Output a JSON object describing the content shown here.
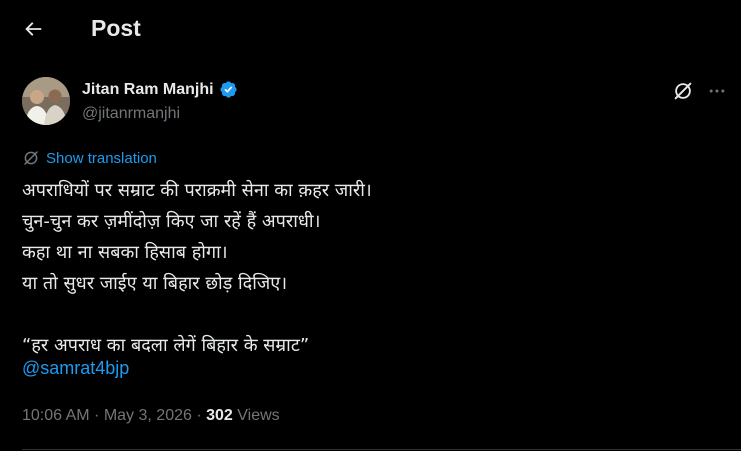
{
  "header": {
    "title": "Post"
  },
  "author": {
    "name": "Jitan Ram Manjhi",
    "handle": "@jitanrmanjhi"
  },
  "translate": {
    "label": "Show translation"
  },
  "tweet": {
    "line1": "अपराधियों पर सम्राट की पराक्रमी सेना का क़हर जारी।",
    "line2": "चुन-चुन कर ज़मींदोज़ किए जा रहें हैं अपराधी।",
    "line3": "कहा था ना सबका हिसाब होगा।",
    "line4": "या तो सुधर जाईए या बिहार छोड़ दिजिए।",
    "quote": "“हर अपराध का बदला लेगें बिहार के सम्राट”",
    "mention": "@samrat4bjp"
  },
  "meta": {
    "time": "10:06 AM",
    "sep1": " · ",
    "date": "May 3, 2026",
    "sep2": " · ",
    "views": "302",
    "views_label": " Views"
  },
  "colors": {
    "background": "#000000",
    "text": "#e7e9ea",
    "muted": "#71767b",
    "link": "#1d9bf0"
  },
  "icons": {
    "back": "arrow-left-icon",
    "verified": "verified-badge-icon",
    "grok": "grok-icon",
    "more": "more-horizontal-icon",
    "translate": "globe-icon"
  }
}
